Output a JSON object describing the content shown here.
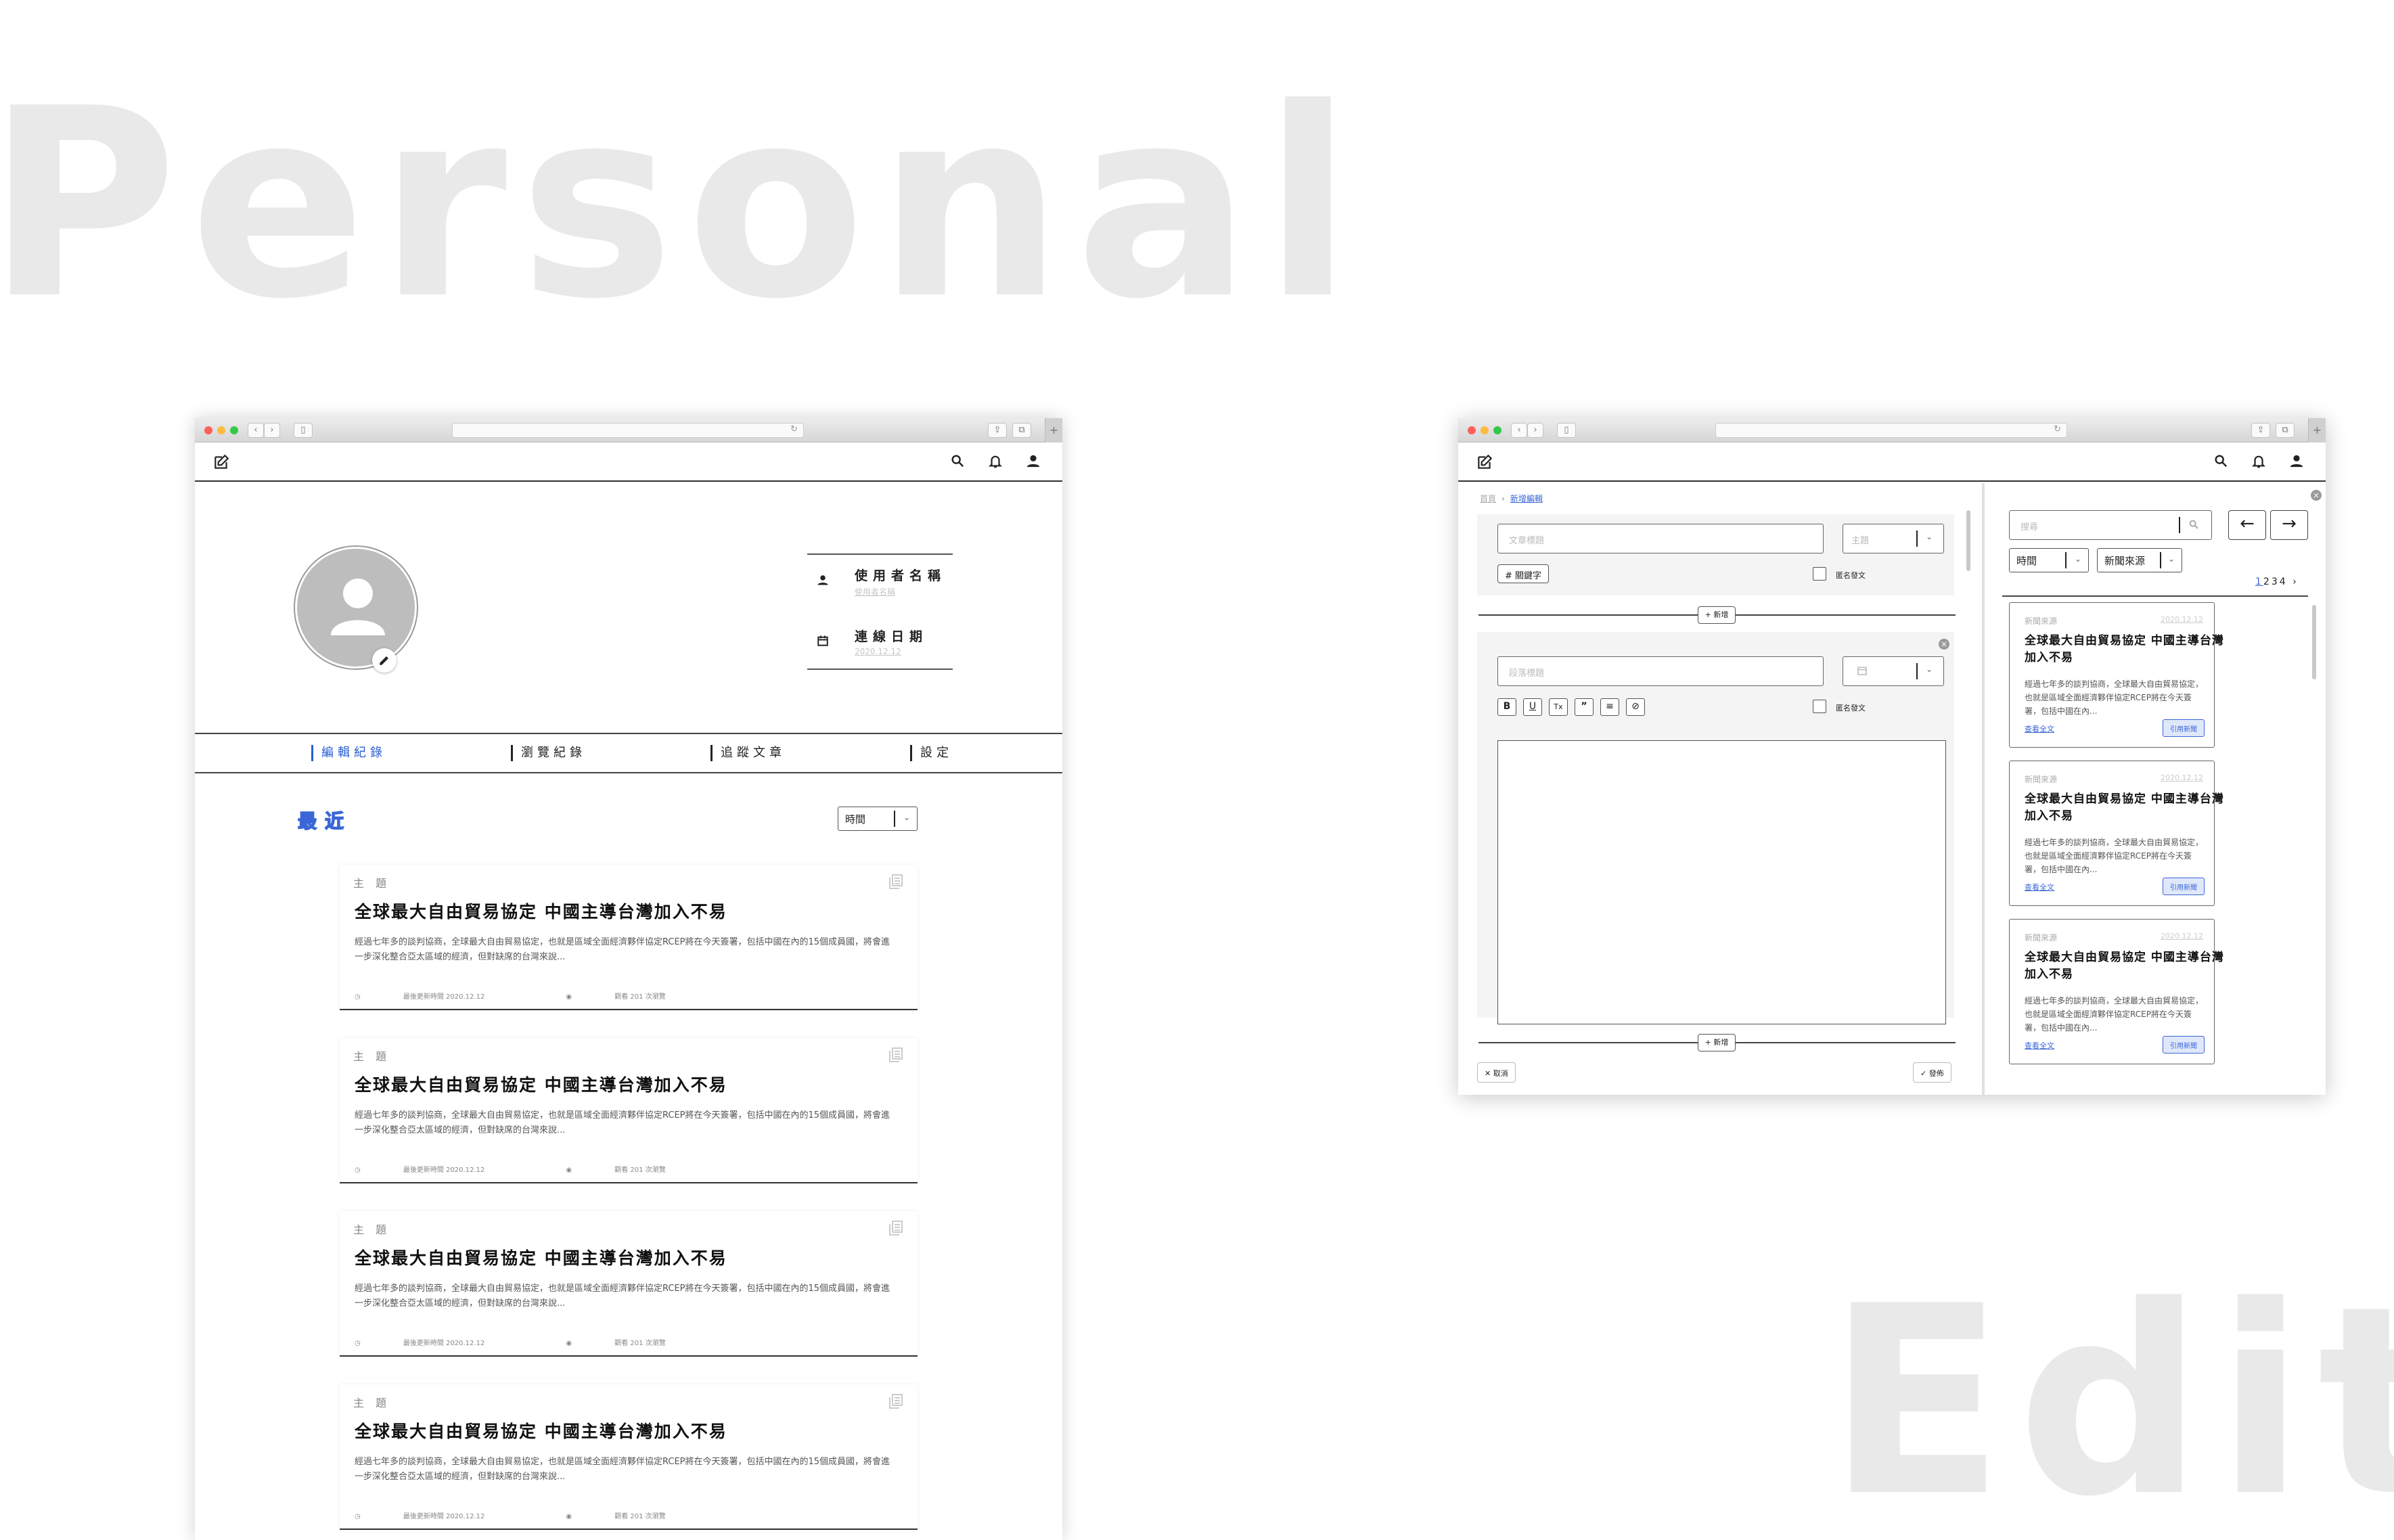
{
  "background": {
    "word1": "Personal",
    "word2": "Edit"
  },
  "left_window": {
    "profile": {
      "username_label": "使用者名稱",
      "username_sub": "使用者名稱",
      "date_label": "連線日期",
      "date_sub": "2020.12.12"
    },
    "tabs": [
      "編輯紀錄",
      "瀏覽紀錄",
      "追蹤文章",
      "設定"
    ],
    "recent_title": "最近",
    "sort_select": "時間",
    "cards": [
      {
        "topic": "主 題",
        "title": "全球最大自由貿易協定 中國主導台灣加入不易",
        "desc": "經過七年多的談判協商，全球最大自由貿易協定，也就是區域全面經濟夥伴協定RCEP將在今天簽署，包括中國在內的15個成員國，將會進一步深化整合亞太區域的經濟，但對缺席的台灣來說...",
        "updated": "最後更新時間 2020.12.12",
        "views": "觀看 201 次瀏覽"
      },
      {
        "topic": "主 題",
        "title": "全球最大自由貿易協定 中國主導台灣加入不易",
        "desc": "經過七年多的談判協商，全球最大自由貿易協定，也就是區域全面經濟夥伴協定RCEP將在今天簽署，包括中國在內的15個成員國，將會進一步深化整合亞太區域的經濟，但對缺席的台灣來說...",
        "updated": "最後更新時間 2020.12.12",
        "views": "觀看 201 次瀏覽"
      },
      {
        "topic": "主 題",
        "title": "全球最大自由貿易協定 中國主導台灣加入不易",
        "desc": "經過七年多的談判協商，全球最大自由貿易協定，也就是區域全面經濟夥伴協定RCEP將在今天簽署，包括中國在內的15個成員國，將會進一步深化整合亞太區域的經濟，但對缺席的台灣來說...",
        "updated": "最後更新時間 2020.12.12",
        "views": "觀看 201 次瀏覽"
      },
      {
        "topic": "主 題",
        "title": "全球最大自由貿易協定 中國主導台灣加入不易",
        "desc": "經過七年多的談判協商，全球最大自由貿易協定，也就是區域全面經濟夥伴協定RCEP將在今天簽署，包括中國在內的15個成員國，將會進一步深化整合亞太區域的經濟，但對缺席的台灣來說...",
        "updated": "最後更新時間 2020.12.12",
        "views": "觀看 201 次瀏覽"
      }
    ]
  },
  "right_window": {
    "breadcrumb": {
      "home": "首頁",
      "current": "新增編輯"
    },
    "title_placeholder": "文章標題",
    "topic_select": "主題",
    "keyword_btn": "# 關鍵字",
    "anon_label": "匿名發文",
    "add_label": "+ 新增",
    "paragraph_placeholder": "段落標題",
    "format_buttons": [
      "B",
      "U",
      "Tx",
      "”",
      "≡",
      "⊘"
    ],
    "cancel_label": "取消",
    "publish_label": "發佈",
    "search_placeholder": "搜尋",
    "filter_time": "時間",
    "filter_source": "新聞來源",
    "pager": [
      "1",
      "2",
      "3",
      "4",
      "›"
    ],
    "news": [
      {
        "source": "新聞來源",
        "date": "2020.12.12",
        "title": "全球最大自由貿易協定 中國主導台灣加入不易",
        "desc": "經過七年多的談判協商，全球最大自由貿易協定，也就是區域全面經濟夥伴協定RCEP將在今天簽署，包括中國在內...",
        "link": "查看全文",
        "cite": "引用新聞"
      },
      {
        "source": "新聞來源",
        "date": "2020.12.12",
        "title": "全球最大自由貿易協定 中國主導台灣加入不易",
        "desc": "經過七年多的談判協商，全球最大自由貿易協定，也就是區域全面經濟夥伴協定RCEP將在今天簽署，包括中國在內...",
        "link": "查看全文",
        "cite": "引用新聞"
      },
      {
        "source": "新聞來源",
        "date": "2020.12.12",
        "title": "全球最大自由貿易協定 中國主導台灣加入不易",
        "desc": "經過七年多的談判協商，全球最大自由貿易協定，也就是區域全面經濟夥伴協定RCEP將在今天簽署，包括中國在內...",
        "link": "查看全文",
        "cite": "引用新聞"
      }
    ]
  },
  "colors": {
    "accent": "#3a66d6",
    "watermark": "#e9e9e9"
  },
  "icons": [
    "compose-icon",
    "search-icon",
    "bell-icon",
    "user-icon",
    "calendar-icon",
    "pen-icon",
    "copy-icon",
    "clock-icon",
    "eye-icon"
  ]
}
